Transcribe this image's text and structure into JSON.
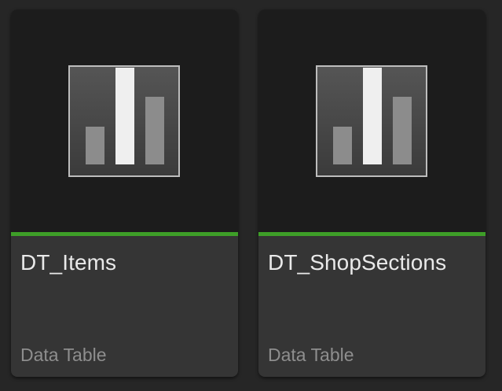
{
  "assets": [
    {
      "name": "DT_Items",
      "type": "Data Table",
      "icon": "data-table-icon",
      "type_color": "#3e9f28"
    },
    {
      "name": "DT_ShopSections",
      "type": "Data Table",
      "icon": "data-table-icon",
      "type_color": "#3e9f28"
    }
  ]
}
